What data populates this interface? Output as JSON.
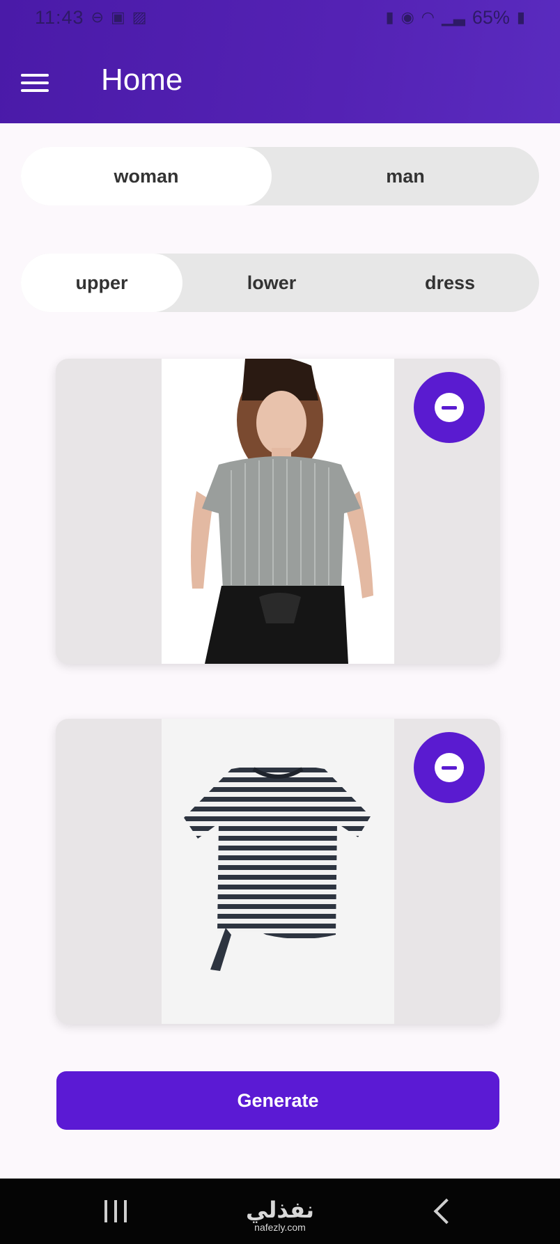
{
  "status_bar": {
    "time": "11:43",
    "battery": "65%",
    "left_icons": [
      "do-not-disturb-icon",
      "video-icon",
      "sim-icon"
    ],
    "right_icons": [
      "battery-saver-icon",
      "alarm-icon",
      "wifi-icon",
      "signal-icon"
    ]
  },
  "app_bar": {
    "title": "Home",
    "menu_icon": "hamburger-menu-icon",
    "color": "#5422b4"
  },
  "gender_toggle": {
    "options": [
      "woman",
      "man"
    ],
    "selected": "woman"
  },
  "category_toggle": {
    "options": [
      "upper",
      "lower",
      "dress"
    ],
    "selected": "upper"
  },
  "cards": [
    {
      "image": "model-wearing-silver-top",
      "remove_icon": "remove-circle-icon"
    },
    {
      "image": "striped-t-shirt",
      "remove_icon": "remove-circle-icon"
    }
  ],
  "generate_button": {
    "label": "Generate",
    "color": "#5b1ad4"
  },
  "nav_bar": {
    "icons": [
      "recents-icon",
      "home-icon",
      "back-icon"
    ]
  },
  "watermark": {
    "text": "نفذلي",
    "sub": "nafezly.com"
  }
}
